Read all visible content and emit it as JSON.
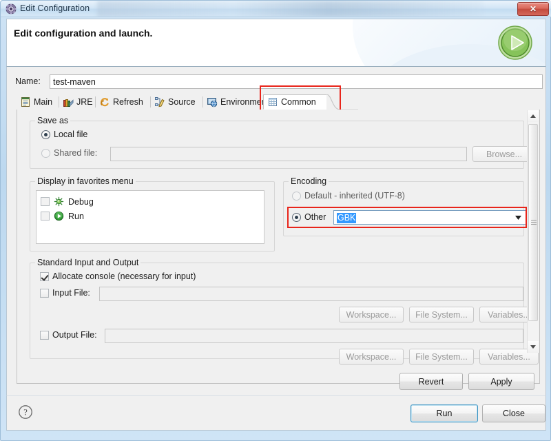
{
  "window": {
    "title": "Edit Configuration",
    "app_icon": "gear-icon",
    "close_label": "✕"
  },
  "banner": {
    "title": "Edit configuration and launch.",
    "icon": "run-play-icon"
  },
  "name_field": {
    "label": "Name:",
    "value": "test-maven",
    "placeholder": ""
  },
  "tabs": [
    {
      "label": "Main",
      "icon": "main-page-icon",
      "selected": false
    },
    {
      "label": "JRE",
      "icon": "jre-books-icon",
      "selected": false
    },
    {
      "label": "Refresh",
      "icon": "refresh-icon",
      "selected": false
    },
    {
      "label": "Source",
      "icon": "source-edit-icon",
      "selected": false
    },
    {
      "label": "Environment",
      "icon": "environment-icon",
      "selected": false
    },
    {
      "label": "Common",
      "icon": "common-table-icon",
      "selected": true
    }
  ],
  "save_as": {
    "legend": "Save as",
    "local_file": {
      "label": "Local file",
      "selected": true
    },
    "shared_file": {
      "label": "Shared file:",
      "selected": false,
      "value": "",
      "enabled": false
    },
    "browse_label": "Browse..."
  },
  "favorites": {
    "legend": "Display in favorites menu",
    "items": [
      {
        "label": "Debug",
        "icon": "debug-bug-icon",
        "checked": false
      },
      {
        "label": "Run",
        "icon": "run-play-icon",
        "checked": false
      }
    ]
  },
  "encoding": {
    "legend": "Encoding",
    "default_option": {
      "label": "Default - inherited (UTF-8)",
      "selected": false
    },
    "other_option": {
      "label": "Other",
      "selected": true
    },
    "value": "GBK",
    "value_selected": true,
    "dropdown_icon": "chevron-down-icon"
  },
  "standard_io": {
    "legend": "Standard Input and Output",
    "allocate_console": {
      "label": "Allocate console (necessary for input)",
      "checked": true
    },
    "input_file": {
      "label": "Input File:",
      "checked": false,
      "value": ""
    },
    "output_file": {
      "label": "Output File:",
      "checked": false,
      "value": ""
    },
    "buttons": [
      {
        "label": "Workspace...",
        "enabled": false
      },
      {
        "label": "File System...",
        "enabled": false
      },
      {
        "label": "Variables...",
        "enabled": false
      }
    ]
  },
  "apply_bar": {
    "revert_label": "Revert",
    "apply_label": "Apply"
  },
  "bottom_bar": {
    "help_icon": "question-mark-icon",
    "run_label": "Run",
    "close_label": "Close"
  },
  "highlights": {
    "color": "#e8251b",
    "targets": [
      "common-tab",
      "encoding-other-row"
    ]
  },
  "colors": {
    "accent_blue": "#3399ff",
    "highlight_red": "#e8251b",
    "panel_bg": "#f0f0f0",
    "title_gradient_start": "#e9f3fb",
    "close_red": "#c44b3e",
    "run_green": "#6db33f"
  }
}
